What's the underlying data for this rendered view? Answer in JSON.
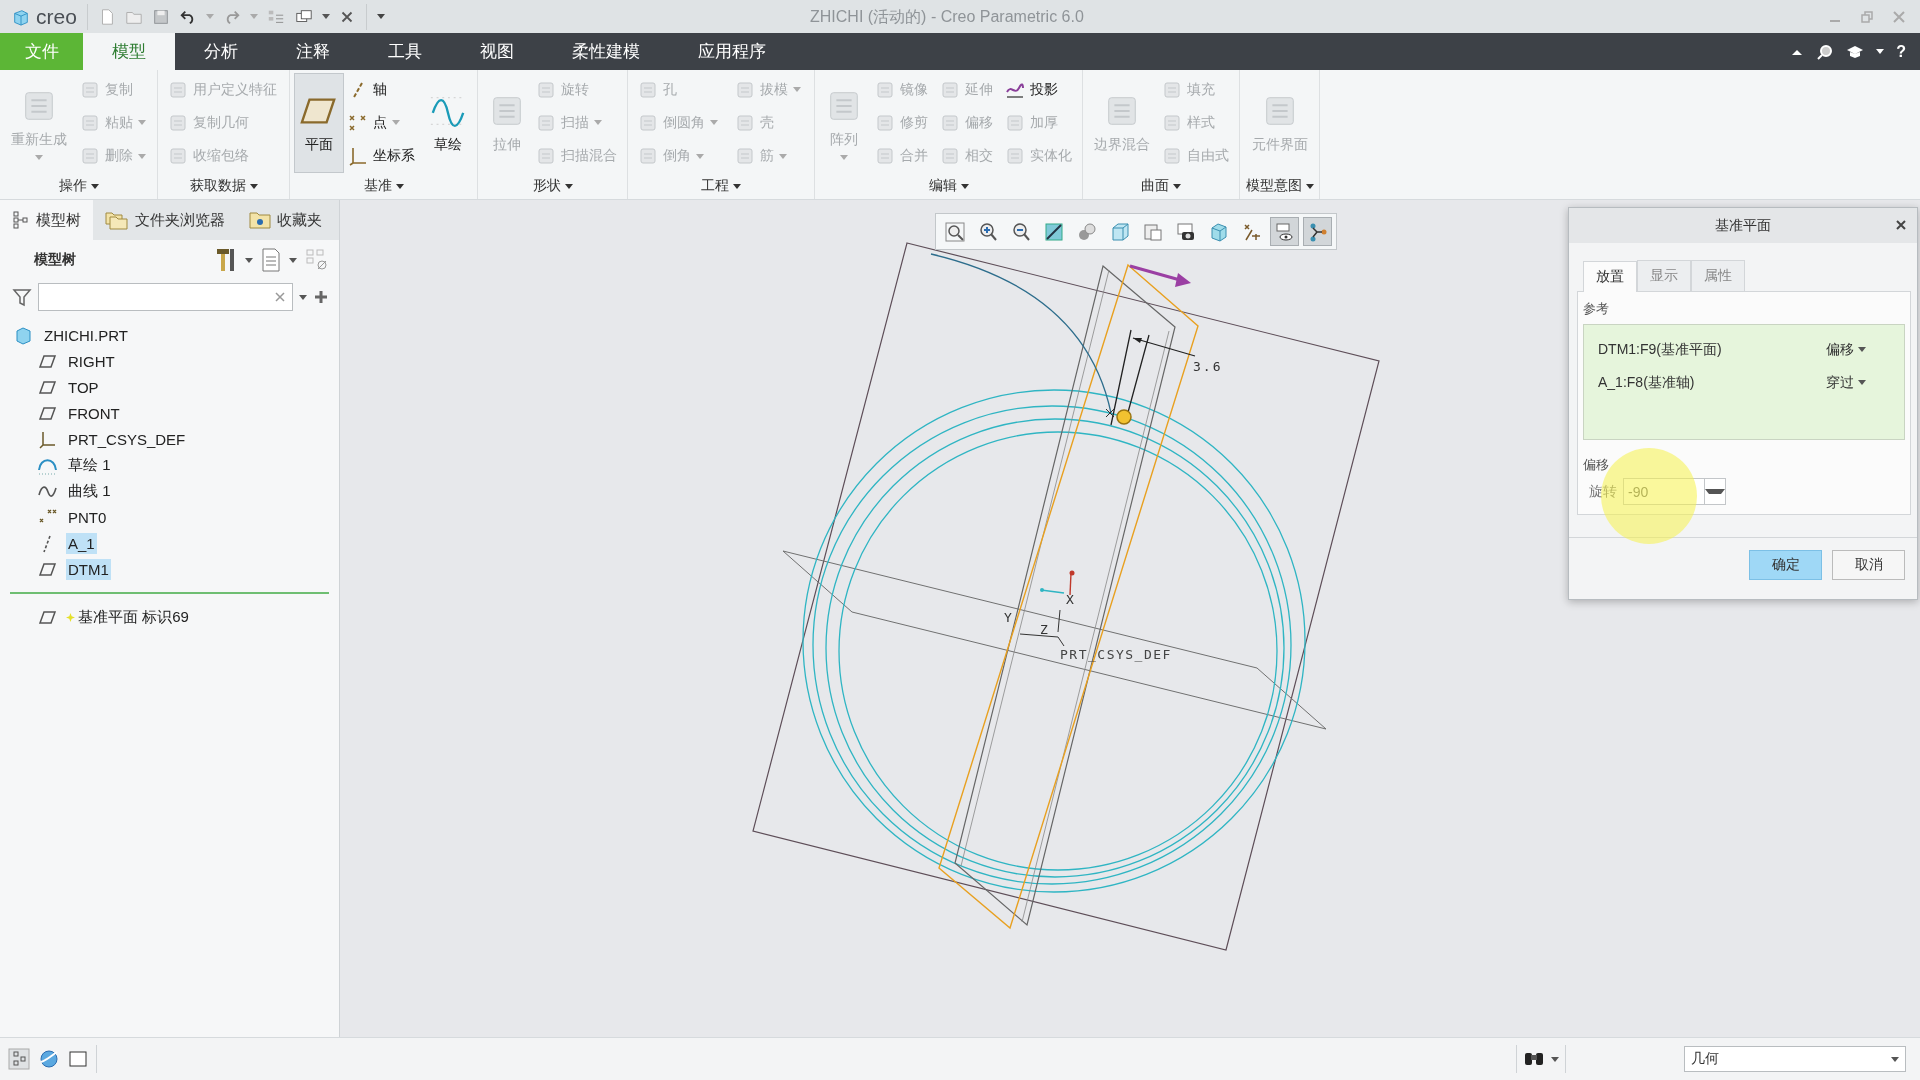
{
  "title_bar": {
    "logo": "creo",
    "title": "ZHICHI (活动的) - Creo Parametric 6.0"
  },
  "menu_tabs": [
    {
      "label": "文件",
      "kind": "file",
      "selected": false
    },
    {
      "label": "模型",
      "kind": "tab",
      "selected": true
    },
    {
      "label": "分析",
      "kind": "tab",
      "selected": false
    },
    {
      "label": "注释",
      "kind": "tab",
      "selected": false
    },
    {
      "label": "工具",
      "kind": "tab",
      "selected": false
    },
    {
      "label": "视图",
      "kind": "tab",
      "selected": false
    },
    {
      "label": "柔性建模",
      "kind": "tab",
      "selected": false
    },
    {
      "label": "应用程序",
      "kind": "tab",
      "selected": false
    }
  ],
  "help": "?",
  "ribbon": [
    {
      "label": "操作",
      "items": [
        {
          "kind": "large",
          "label": "重新生成",
          "disabled": true,
          "dropdown": true,
          "selected": false
        },
        {
          "kind": "small",
          "label": "复制",
          "disabled": true,
          "dropdown": false,
          "selected": false
        },
        {
          "kind": "small",
          "label": "粘贴",
          "disabled": true,
          "dropdown": true,
          "selected": false
        },
        {
          "kind": "small",
          "label": "删除",
          "disabled": true,
          "dropdown": true,
          "selected": false
        }
      ]
    },
    {
      "label": "获取数据",
      "items": [
        {
          "kind": "small",
          "label": "用户定义特征",
          "disabled": true,
          "dropdown": false,
          "selected": false
        },
        {
          "kind": "small",
          "label": "复制几何",
          "disabled": true,
          "dropdown": false,
          "selected": false
        },
        {
          "kind": "small",
          "label": "收缩包络",
          "disabled": true,
          "dropdown": false,
          "selected": false
        }
      ]
    },
    {
      "label": "基准",
      "items": [
        {
          "kind": "large",
          "label": "平面",
          "disabled": false,
          "dropdown": false,
          "selected": true
        },
        {
          "kind": "small",
          "label": "轴",
          "disabled": false,
          "dropdown": false,
          "selected": false
        },
        {
          "kind": "small",
          "label": "点",
          "disabled": false,
          "dropdown": true,
          "selected": false
        },
        {
          "kind": "small",
          "label": "坐标系",
          "disabled": false,
          "dropdown": false,
          "selected": false
        },
        {
          "kind": "large",
          "label": "草绘",
          "disabled": false,
          "dropdown": false,
          "selected": false
        }
      ]
    },
    {
      "label": "形状",
      "items": [
        {
          "kind": "large",
          "label": "拉伸",
          "disabled": true,
          "dropdown": false,
          "selected": false
        },
        {
          "kind": "small",
          "label": "旋转",
          "disabled": true,
          "dropdown": false,
          "selected": false
        },
        {
          "kind": "small",
          "label": "扫描",
          "disabled": true,
          "dropdown": true,
          "selected": false
        },
        {
          "kind": "small",
          "label": "扫描混合",
          "disabled": true,
          "dropdown": false,
          "selected": false
        }
      ]
    },
    {
      "label": "工程",
      "items": [
        {
          "kind": "small",
          "label": "孔",
          "disabled": true,
          "dropdown": false,
          "selected": false
        },
        {
          "kind": "small",
          "label": "倒圆角",
          "disabled": true,
          "dropdown": true,
          "selected": false
        },
        {
          "kind": "small",
          "label": "倒角",
          "disabled": true,
          "dropdown": true,
          "selected": false
        },
        {
          "kind": "small",
          "label": "拔模",
          "disabled": true,
          "dropdown": true,
          "selected": false
        },
        {
          "kind": "small",
          "label": "壳",
          "disabled": true,
          "dropdown": false,
          "selected": false
        },
        {
          "kind": "small",
          "label": "筋",
          "disabled": true,
          "dropdown": true,
          "selected": false
        }
      ]
    },
    {
      "label": "编辑",
      "items": [
        {
          "kind": "large",
          "label": "阵列",
          "disabled": true,
          "dropdown": true,
          "selected": false
        },
        {
          "kind": "small",
          "label": "镜像",
          "disabled": true,
          "dropdown": false,
          "selected": false
        },
        {
          "kind": "small",
          "label": "修剪",
          "disabled": true,
          "dropdown": false,
          "selected": false
        },
        {
          "kind": "small",
          "label": "合并",
          "disabled": true,
          "dropdown": false,
          "selected": false
        },
        {
          "kind": "small",
          "label": "延伸",
          "disabled": true,
          "dropdown": false,
          "selected": false
        },
        {
          "kind": "small",
          "label": "偏移",
          "disabled": true,
          "dropdown": false,
          "selected": false
        },
        {
          "kind": "small",
          "label": "相交",
          "disabled": true,
          "dropdown": false,
          "selected": false
        },
        {
          "kind": "small",
          "label": "投影",
          "disabled": false,
          "dropdown": false,
          "selected": false
        },
        {
          "kind": "small",
          "label": "加厚",
          "disabled": true,
          "dropdown": false,
          "selected": false
        },
        {
          "kind": "small",
          "label": "实体化",
          "disabled": true,
          "dropdown": false,
          "selected": false
        }
      ]
    },
    {
      "label": "曲面",
      "items": [
        {
          "kind": "large",
          "label": "边界混合",
          "disabled": true,
          "dropdown": false,
          "selected": false
        },
        {
          "kind": "small",
          "label": "填充",
          "disabled": true,
          "dropdown": false,
          "selected": false
        },
        {
          "kind": "small",
          "label": "样式",
          "disabled": true,
          "dropdown": false,
          "selected": false
        },
        {
          "kind": "small",
          "label": "自由式",
          "disabled": true,
          "dropdown": false,
          "selected": false
        }
      ]
    },
    {
      "label": "模型意图",
      "items": [
        {
          "kind": "large",
          "label": "元件界面",
          "disabled": true,
          "dropdown": false,
          "selected": false
        }
      ]
    }
  ],
  "left_panel": {
    "tabs": [
      {
        "label": "模型树",
        "selected": true
      },
      {
        "label": "文件夹浏览器",
        "selected": false
      },
      {
        "label": "收藏夹",
        "selected": false
      }
    ],
    "header": "模型树",
    "tree": [
      {
        "label": "ZHICHI.PRT",
        "kind": "part",
        "selected": false,
        "children": [
          {
            "label": "RIGHT",
            "kind": "plane",
            "selected": false
          },
          {
            "label": "TOP",
            "kind": "plane",
            "selected": false
          },
          {
            "label": "FRONT",
            "kind": "plane",
            "selected": false
          },
          {
            "label": "PRT_CSYS_DEF",
            "kind": "csys",
            "selected": false
          },
          {
            "label": "草绘 1",
            "kind": "sketch",
            "selected": false
          },
          {
            "label": "曲线 1",
            "kind": "curve",
            "selected": false
          },
          {
            "label": "PNT0",
            "kind": "point",
            "selected": false
          },
          {
            "label": "A_1",
            "kind": "axis",
            "selected": true
          },
          {
            "label": "DTM1",
            "kind": "plane",
            "selected": true
          }
        ]
      }
    ],
    "insert_item": {
      "label": "基准平面 标识69",
      "kind": "plane"
    }
  },
  "view_toolbar": [
    {
      "pressed": false
    },
    {
      "pressed": false
    },
    {
      "pressed": false
    },
    {
      "pressed": false
    },
    {
      "pressed": false
    },
    {
      "pressed": false
    },
    {
      "pressed": false
    },
    {
      "pressed": false
    },
    {
      "pressed": false
    },
    {
      "pressed": false
    },
    {
      "pressed": true
    },
    {
      "pressed": true
    }
  ],
  "graphics": {
    "dimension": "3.6",
    "csys_label": "PRT_CSYS_DEF",
    "axis_labels": [
      "X",
      "Y",
      "Z"
    ]
  },
  "dialog": {
    "title": "基准平面",
    "tabs": [
      {
        "label": "放置",
        "selected": true
      },
      {
        "label": "显示",
        "selected": false
      },
      {
        "label": "属性",
        "selected": false
      }
    ],
    "references_label": "参考",
    "references": [
      {
        "name": "DTM1:F9(基准平面)",
        "constraint": "偏移"
      },
      {
        "name": "A_1:F8(基准轴)",
        "constraint": "穿过"
      }
    ],
    "offset_label": "偏移",
    "rotation_label": "旋转",
    "rotation_value": "-90",
    "buttons": [
      {
        "label": "确定",
        "kind": "primary"
      },
      {
        "label": "取消",
        "kind": "secondary"
      }
    ]
  },
  "status_bar": {
    "filter": "几何"
  }
}
